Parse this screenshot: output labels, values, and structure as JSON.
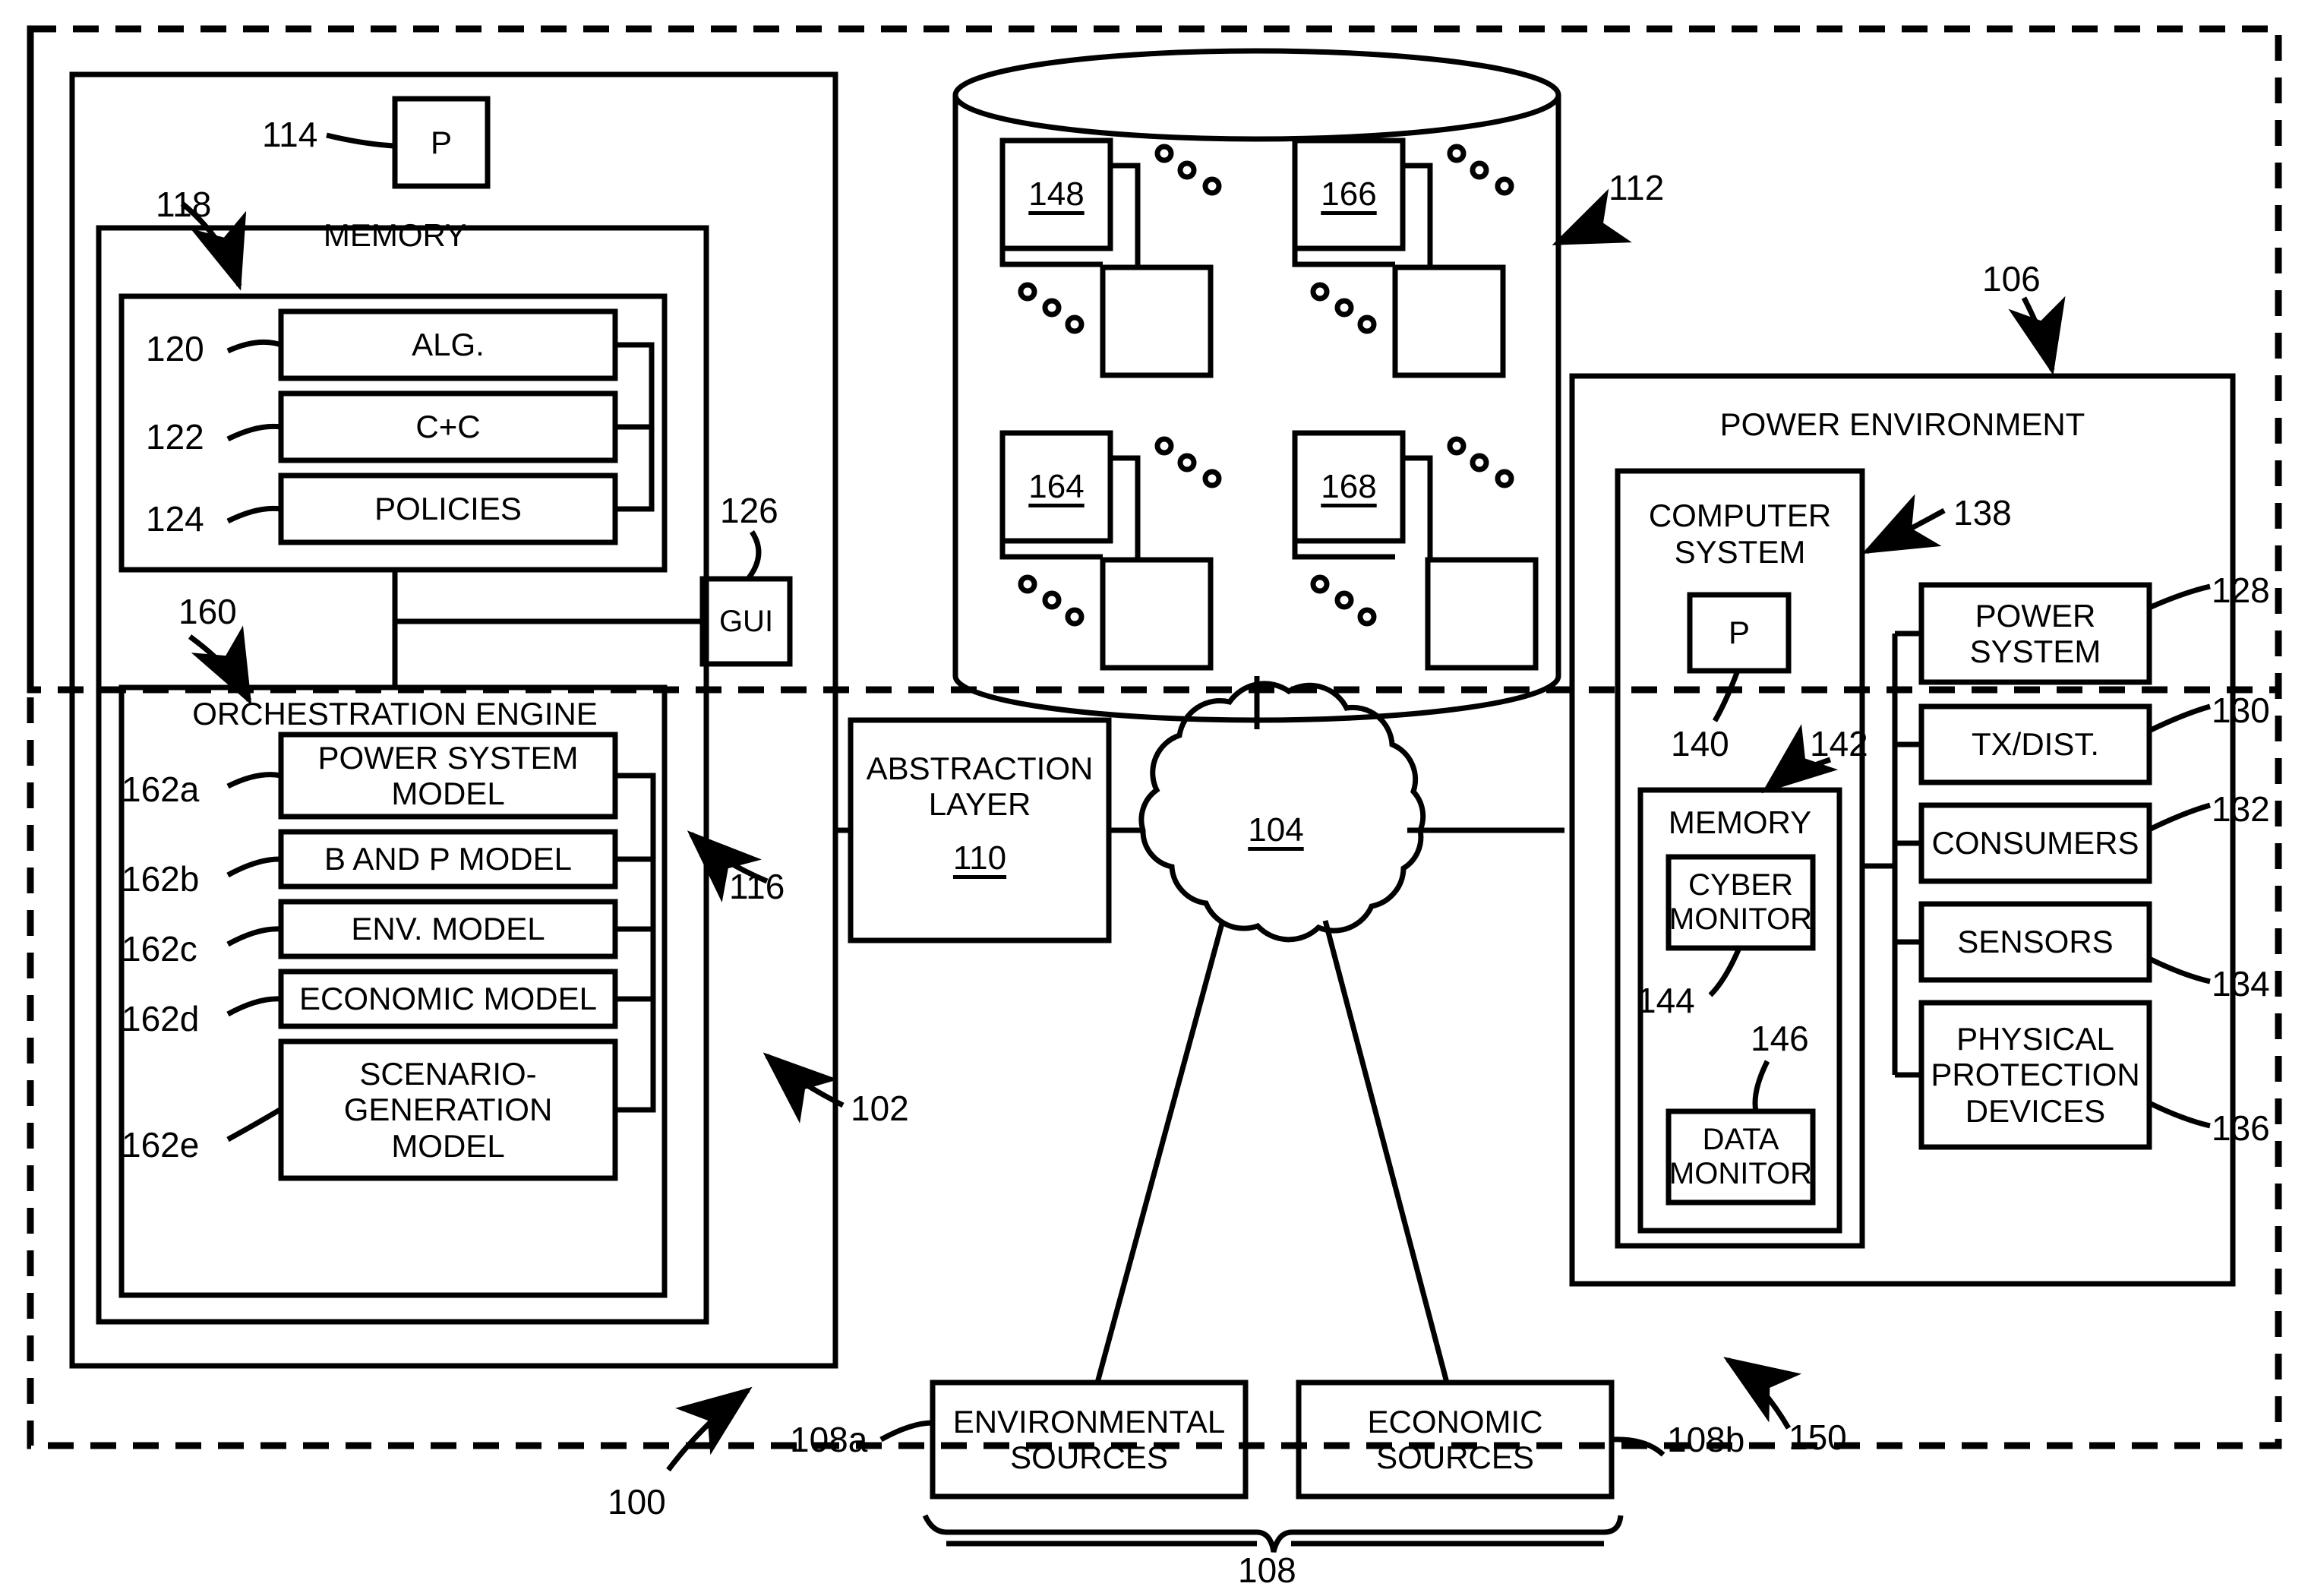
{
  "figure": {
    "outer_boundary_ref": "150",
    "system_ref": "100"
  },
  "left_system": {
    "ref": "102",
    "inner_ref": "116",
    "processor": {
      "label": "P",
      "ref": "114"
    },
    "memory": {
      "title": "MEMORY",
      "ref": "118",
      "items": [
        {
          "label": "ALG.",
          "ref": "120"
        },
        {
          "label": "C+C",
          "ref": "122"
        },
        {
          "label": "POLICIES",
          "ref": "124"
        }
      ]
    },
    "gui": {
      "label": "GUI",
      "ref": "126"
    },
    "orchestration": {
      "title": "ORCHESTRATION ENGINE",
      "ref": "160",
      "models": [
        {
          "label": "POWER SYSTEM MODEL",
          "ref": "162a"
        },
        {
          "label": "B AND P MODEL",
          "ref": "162b"
        },
        {
          "label": "ENV. MODEL",
          "ref": "162c"
        },
        {
          "label": "ECONOMIC MODEL",
          "ref": "162d"
        },
        {
          "label": "SCENARIO-GENERATION MODEL",
          "ref": "162e"
        }
      ]
    }
  },
  "database": {
    "ref": "112",
    "groups": [
      {
        "label": "148"
      },
      {
        "label": "166"
      },
      {
        "label": "164"
      },
      {
        "label": "168"
      }
    ]
  },
  "abstraction_layer": {
    "title": "ABSTRACTION LAYER",
    "ref": "110"
  },
  "network_cloud": {
    "ref": "104"
  },
  "power_environment": {
    "title": "POWER ENVIRONMENT",
    "ref": "106",
    "computer_system": {
      "title": "COMPUTER SYSTEM",
      "ref": "138",
      "processor": {
        "label": "P",
        "ref": "140"
      },
      "memory": {
        "title": "MEMORY",
        "ref": "142",
        "items": [
          {
            "label": "CYBER MONITOR",
            "ref": "144"
          },
          {
            "label": "DATA MONITOR",
            "ref": "146"
          }
        ]
      }
    },
    "components": [
      {
        "label": "POWER SYSTEM",
        "ref": "128"
      },
      {
        "label": "TX/DIST.",
        "ref": "130"
      },
      {
        "label": "CONSUMERS",
        "ref": "132"
      },
      {
        "label": "SENSORS",
        "ref": "134"
      },
      {
        "label": "PHYSICAL PROTECTION DEVICES",
        "ref": "136"
      }
    ]
  },
  "sources": {
    "group_ref": "108",
    "items": [
      {
        "label": "ENVIRONMENTAL SOURCES",
        "ref": "108a"
      },
      {
        "label": "ECONOMIC SOURCES",
        "ref": "108b"
      }
    ]
  }
}
